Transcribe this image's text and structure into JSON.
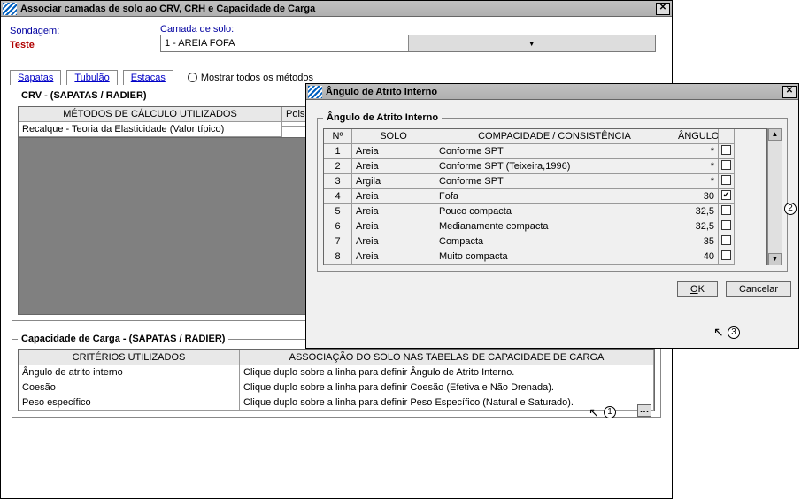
{
  "main": {
    "title": "Associar camadas de solo ao CRV,  CRH e Capacidade de Carga",
    "sondagem_label": "Sondagem:",
    "sondagem_value": "Teste",
    "camada_label": "Camada de solo:",
    "camada_value": "1 - AREIA FOFA",
    "tabs": {
      "sapatas": "Sapatas",
      "tubulao": "Tubulão",
      "estacas": "Estacas"
    },
    "radio_label": "Mostrar todos os métodos",
    "crv": {
      "legend": "CRV - (SAPATAS / RADIER)",
      "col1": "MÉTODOS DE CÁLCULO UTILIZADOS",
      "col2": "Poisson",
      "row1_c1": "Recalque - Teoria da Elasticidade (Valor típico)",
      "row1_c2": ""
    },
    "capacity": {
      "legend": "Capacidade de Carga - (SAPATAS / RADIER)",
      "col1": "CRITÉRIOS UTILIZADOS",
      "col2": "ASSOCIAÇÃO DO SOLO NAS TABELAS DE CAPACIDADE DE CARGA",
      "rows": [
        {
          "c1": "Ângulo de atrito interno",
          "c2": "Clique duplo sobre a linha para definir Ângulo de Atrito Interno."
        },
        {
          "c1": "Coesão",
          "c2": "Clique duplo sobre a linha para definir Coesão (Efetiva e Não Drenada)."
        },
        {
          "c1": "Peso específico",
          "c2": "Clique duplo sobre a linha para definir Peso Específico (Natural e Saturado)."
        }
      ]
    }
  },
  "dialog": {
    "title": "Ângulo de Atrito Interno",
    "legend": "Ângulo de Atrito Interno",
    "h_n": "Nº",
    "h_solo": "SOLO",
    "h_comp": "COMPACIDADE / CONSISTÊNCIA",
    "h_ang": "ÂNGULO",
    "rows": [
      {
        "n": "1",
        "solo": "Areia",
        "comp": "Conforme SPT",
        "ang": "*",
        "chk": false
      },
      {
        "n": "2",
        "solo": "Areia",
        "comp": "Conforme SPT (Teixeira,1996)",
        "ang": "*",
        "chk": false
      },
      {
        "n": "3",
        "solo": "Argila",
        "comp": "Conforme SPT",
        "ang": "*",
        "chk": false
      },
      {
        "n": "4",
        "solo": "Areia",
        "comp": "Fofa",
        "ang": "30",
        "chk": true
      },
      {
        "n": "5",
        "solo": "Areia",
        "comp": "Pouco compacta",
        "ang": "32,5",
        "chk": false
      },
      {
        "n": "6",
        "solo": "Areia",
        "comp": "Medianamente compacta",
        "ang": "32,5",
        "chk": false
      },
      {
        "n": "7",
        "solo": "Areia",
        "comp": "Compacta",
        "ang": "35",
        "chk": false
      },
      {
        "n": "8",
        "solo": "Areia",
        "comp": "Muito compacta",
        "ang": "40",
        "chk": false
      }
    ],
    "ok": "OK",
    "cancel": "Cancelar"
  },
  "callouts": {
    "c1": "1",
    "c2": "2",
    "c3": "3"
  }
}
